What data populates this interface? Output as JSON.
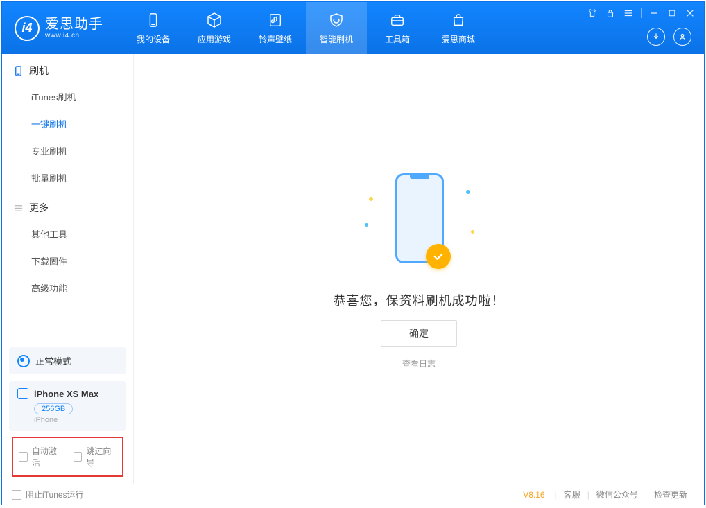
{
  "app": {
    "title": "爱思助手",
    "subtitle": "www.i4.cn"
  },
  "nav": [
    {
      "label": "我的设备",
      "icon": "device"
    },
    {
      "label": "应用游戏",
      "icon": "cube"
    },
    {
      "label": "铃声壁纸",
      "icon": "music"
    },
    {
      "label": "智能刷机",
      "icon": "shield",
      "active": true
    },
    {
      "label": "工具箱",
      "icon": "toolbox"
    },
    {
      "label": "爱思商城",
      "icon": "bag"
    }
  ],
  "sidebar": {
    "group1": {
      "title": "刷机",
      "items": [
        "iTunes刷机",
        "一键刷机",
        "专业刷机",
        "批量刷机"
      ],
      "active_index": 1
    },
    "group2": {
      "title": "更多",
      "items": [
        "其他工具",
        "下载固件",
        "高级功能"
      ]
    }
  },
  "mode": {
    "label": "正常模式"
  },
  "device": {
    "name": "iPhone XS Max",
    "capacity": "256GB",
    "type": "iPhone"
  },
  "options": {
    "auto_activate": "自动激活",
    "skip_guide": "跳过向导"
  },
  "main": {
    "success_text": "恭喜您，保资料刷机成功啦！",
    "ok_label": "确定",
    "log_label": "查看日志"
  },
  "footer": {
    "block_itunes": "阻止iTunes运行",
    "version": "V8.16",
    "links": [
      "客服",
      "微信公众号",
      "检查更新"
    ]
  }
}
